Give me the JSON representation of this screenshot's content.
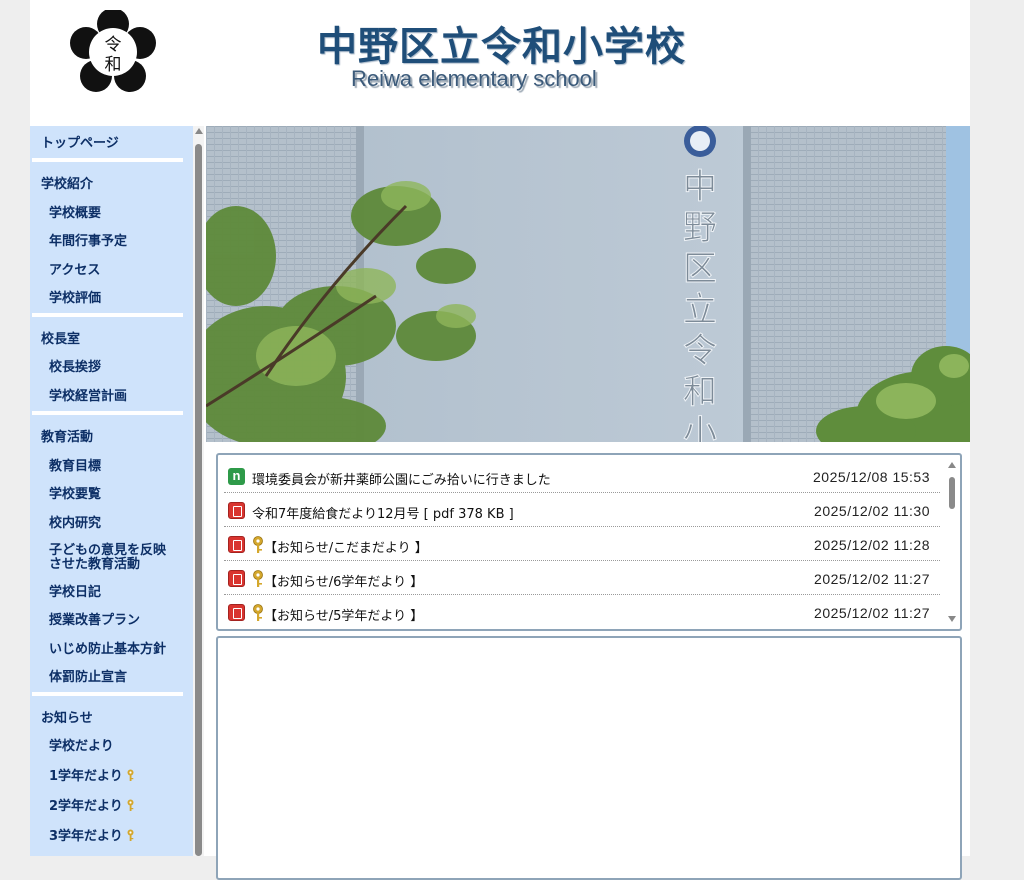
{
  "header": {
    "title": "中野区立令和小学校",
    "subtitle": "Reiwa elementary school",
    "emblem_chars": [
      "令",
      "和"
    ]
  },
  "sidebar": {
    "sections": [
      {
        "label": "トップページ",
        "items": []
      },
      {
        "label": "学校紹介",
        "items": [
          {
            "label": "学校概要"
          },
          {
            "label": "年間行事予定"
          },
          {
            "label": "アクセス"
          },
          {
            "label": "学校評価"
          }
        ]
      },
      {
        "label": "校長室",
        "items": [
          {
            "label": "校長挨拶"
          },
          {
            "label": "学校経営計画"
          }
        ]
      },
      {
        "label": "教育活動",
        "items": [
          {
            "label": "教育目標"
          },
          {
            "label": "学校要覧"
          },
          {
            "label": "校内研究"
          },
          {
            "label": "子どもの意見を反映",
            "label2": "させた教育活動"
          },
          {
            "label": "学校日記"
          },
          {
            "label": "授業改善プラン"
          },
          {
            "label": "いじめ防止基本方針"
          },
          {
            "label": "体罰防止宣言"
          }
        ]
      },
      {
        "label": "お知らせ",
        "items": [
          {
            "label": "学校だより"
          },
          {
            "label": "1学年だより",
            "icon": "key-icon"
          },
          {
            "label": "2学年だより",
            "icon": "key-icon"
          },
          {
            "label": "3学年だより",
            "icon": "key-icon"
          }
        ]
      }
    ]
  },
  "hero": {
    "sign_chars": [
      "中",
      "野",
      "区",
      "立",
      "令",
      "和",
      "小"
    ]
  },
  "news": {
    "items": [
      {
        "icon": "new-icon",
        "icon_text": "n",
        "locked": false,
        "title": "環境委員会が新井薬師公園にごみ拾いに行きました",
        "date": "2025/12/08 15:53"
      },
      {
        "icon": "pdf-icon",
        "locked": false,
        "title": "令和7年度給食だより12月号 [ pdf 378 KB ]",
        "date": "2025/12/02 11:30"
      },
      {
        "icon": "pdf-icon",
        "locked": true,
        "title": "【お知らせ/こだまだより 】",
        "date": "2025/12/02 11:28"
      },
      {
        "icon": "pdf-icon",
        "locked": true,
        "title": "【お知らせ/6学年だより 】",
        "date": "2025/12/02 11:27"
      },
      {
        "icon": "pdf-icon",
        "locked": true,
        "title": "【お知らせ/5学年だより 】",
        "date": "2025/12/02 11:27"
      }
    ]
  },
  "colors": {
    "title": "#1f4e79",
    "sidebar_bg": "#cfe3fb",
    "nav_text": "#0d2f66",
    "box_border": "#8ea4b8",
    "pdf_red": "#d9342f",
    "new_green": "#2e9a49",
    "key_gold": "#d4a72c"
  }
}
